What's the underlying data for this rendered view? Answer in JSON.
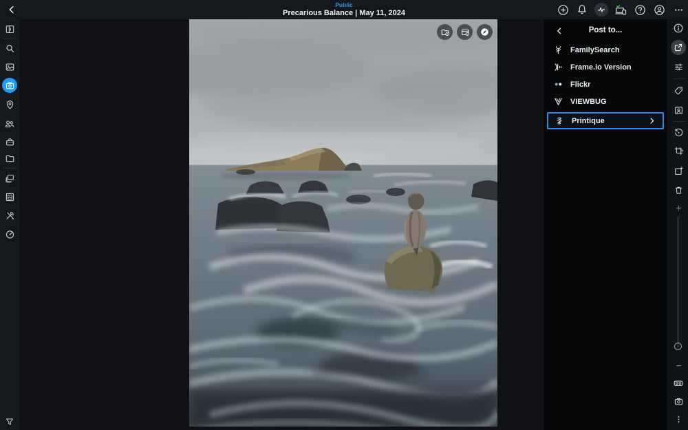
{
  "top_bar": {
    "visibility_label": "Public",
    "title": "Precarious Balance | May 11, 2024",
    "left_icons": [
      "back-icon"
    ],
    "right_icons": [
      "add-icon",
      "notifications-icon",
      "activity-icon",
      "devices-sync-icon",
      "help-icon",
      "account-icon",
      "more-icon"
    ]
  },
  "left_rail": {
    "items": [
      "panel-layout-icon",
      "search-icon",
      "photos-icon",
      "camera-icon",
      "map-pin-icon",
      "people-icon",
      "bag-icon",
      "folder-icon",
      "albums-stack-icon",
      "framed-photo-icon",
      "tools-icon",
      "gauge-icon",
      "filter-icon"
    ],
    "selected": "camera-icon"
  },
  "photo": {
    "description": "Overcast seascape: balanced stone stack on a rock amid long-exposure swirling surf, tan island on horizon",
    "overlay_buttons": [
      "add-to-album-icon",
      "move-to-album-icon",
      "compass-icon"
    ]
  },
  "share_panel": {
    "title": "Post to...",
    "back_icon": "chevron-left-icon",
    "items": [
      {
        "label": "FamilySearch",
        "icon": "familysearch-icon",
        "selected": false
      },
      {
        "label": "Frame.io Version",
        "icon": "frameio-icon",
        "selected": false
      },
      {
        "label": "Flickr",
        "icon": "flickr-icon",
        "selected": false
      },
      {
        "label": "VIEWBUG",
        "icon": "viewbug-icon",
        "selected": false
      },
      {
        "label": "Printique",
        "icon": "printique-icon",
        "selected": true,
        "has_chevron": true
      }
    ]
  },
  "right_rail": {
    "items": [
      "info-icon",
      "share-icon",
      "edit-sliders-icon",
      "tag-icon",
      "person-badge-icon",
      "history-icon",
      "crop-rotate-icon",
      "new-version-icon",
      "trash-icon",
      "zoom-in-icon",
      "zoom-slider",
      "zoom-out-icon",
      "compare-view-icon",
      "camera-info-icon",
      "kebab-menu-icon"
    ],
    "selected": "share-icon"
  },
  "colors": {
    "accent_blue": "#1f9cf5",
    "selection_border_blue": "#1f8ff5",
    "public_label_blue": "#2e9be6",
    "sync_check_green": "#47b04b",
    "top_bar_bg": "#14181d",
    "panel_bg": "#060709",
    "canvas_bg": "#0f1114"
  }
}
